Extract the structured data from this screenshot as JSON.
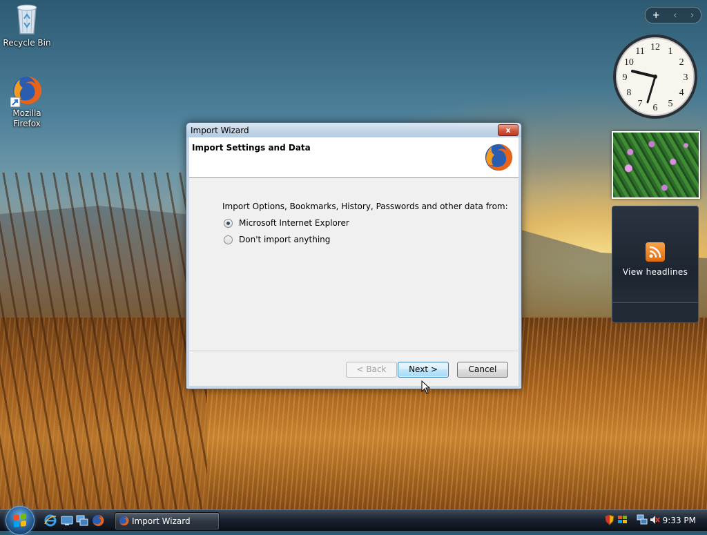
{
  "desktop": {
    "icons": [
      {
        "label": "Recycle Bin"
      },
      {
        "label": "Mozilla Firefox"
      }
    ]
  },
  "sidebar": {
    "controls": {
      "add": "+",
      "prev": "‹",
      "next": "›"
    },
    "clock": {
      "numbers": [
        "12",
        "1",
        "2",
        "3",
        "4",
        "5",
        "6",
        "7",
        "8",
        "9",
        "10",
        "11"
      ],
      "time": "9:33"
    },
    "feeds": {
      "label": "View headlines"
    }
  },
  "dialog": {
    "title": "Import Wizard",
    "heading": "Import Settings and Data",
    "prompt": "Import Options, Bookmarks, History, Passwords and other data from:",
    "options": [
      {
        "label": "Microsoft Internet Explorer",
        "checked": true
      },
      {
        "label": "Don't import anything",
        "checked": false
      }
    ],
    "buttons": {
      "back": "< Back",
      "next": "Next >",
      "cancel": "Cancel"
    },
    "close": "x"
  },
  "taskbar": {
    "task_label": "Import Wizard",
    "time": "9:33 PM"
  },
  "colors": {
    "accent": "#3c7fb1",
    "title_bar": "#c4d6e8"
  }
}
